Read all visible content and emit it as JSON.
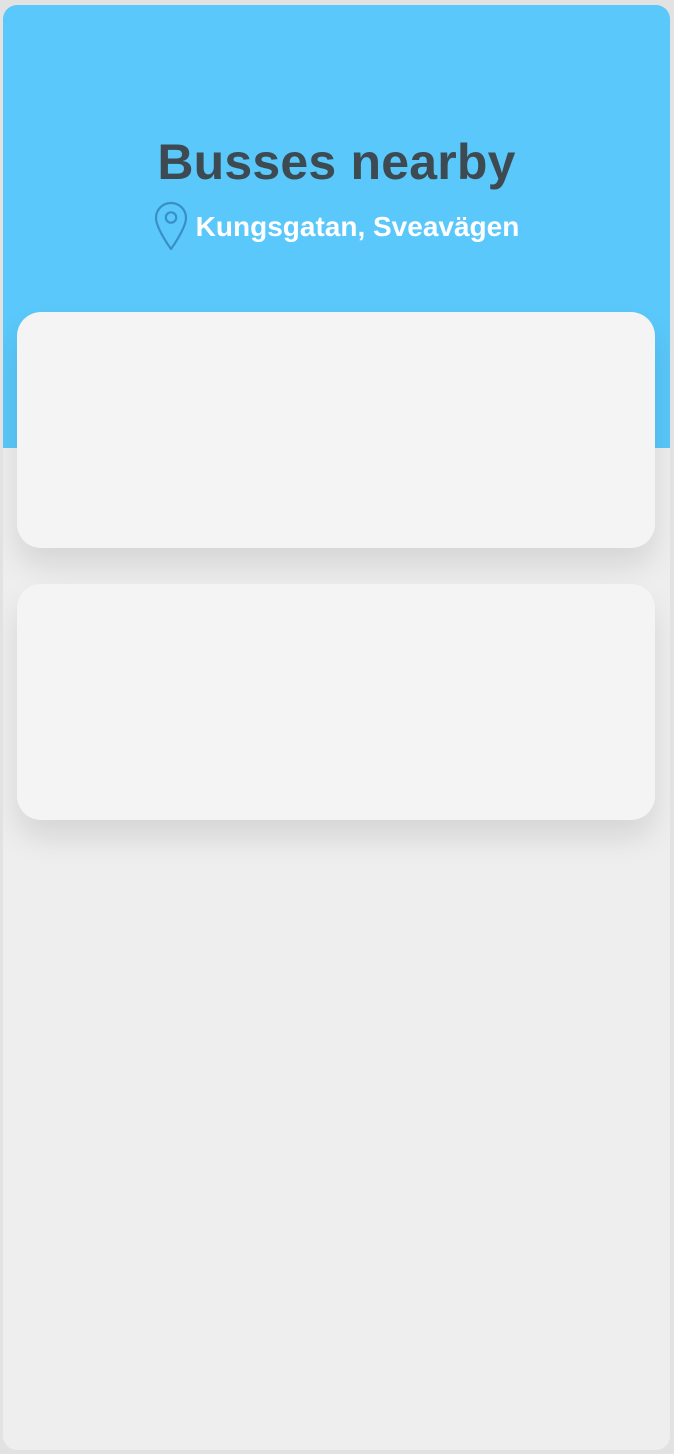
{
  "screen": {
    "title": "Busses nearby",
    "location": "Kungsgatan, Sveavägen",
    "location_icon": "map-pin-icon"
  },
  "colors": {
    "header_bg": "#5ac8fa",
    "title_text": "#3e4a52",
    "location_text": "#ffffff",
    "card_bg": "#f4f4f4",
    "page_bg": "#eeeeee"
  },
  "cards": [
    {
      "content": ""
    },
    {
      "content": ""
    }
  ]
}
